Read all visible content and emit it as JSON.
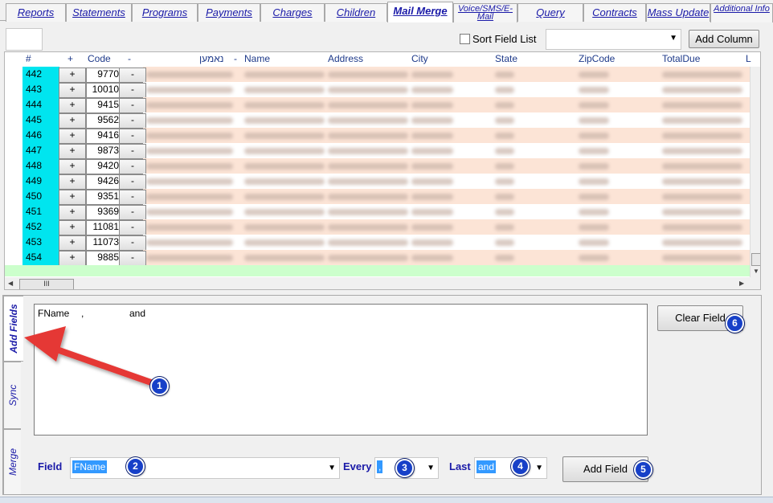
{
  "tabs": [
    {
      "label": "Reports"
    },
    {
      "label": "Statements"
    },
    {
      "label": "Programs"
    },
    {
      "label": "Payments"
    },
    {
      "label": "Charges"
    },
    {
      "label": "Children"
    },
    {
      "label": "Mail Merge"
    },
    {
      "label": "Voice/SMS/E-Mail"
    },
    {
      "label": "Query"
    },
    {
      "label": "Contracts"
    },
    {
      "label": "Mass Update"
    },
    {
      "label": "Additional Info"
    }
  ],
  "toolbar": {
    "sort_field_list": "Sort Field List",
    "add_column": "Add Column"
  },
  "grid": {
    "headers": {
      "num": "#",
      "plus": "+",
      "code": "Code",
      "minus": "-",
      "hebrew": "נאמען",
      "minus2": "-",
      "name": "Name",
      "address": "Address",
      "city": "City",
      "state": "State",
      "zipcode": "ZipCode",
      "totaldue": "TotalDue",
      "more": "L"
    },
    "plus_label": "+",
    "minus_label": "-",
    "hscroll_thumb": "III",
    "rows": [
      {
        "num": "442",
        "code": "9770"
      },
      {
        "num": "443",
        "code": "10010"
      },
      {
        "num": "444",
        "code": "9415"
      },
      {
        "num": "445",
        "code": "9562"
      },
      {
        "num": "446",
        "code": "9416"
      },
      {
        "num": "447",
        "code": "9873"
      },
      {
        "num": "448",
        "code": "9420"
      },
      {
        "num": "449",
        "code": "9426"
      },
      {
        "num": "450",
        "code": "9351"
      },
      {
        "num": "451",
        "code": "9369"
      },
      {
        "num": "452",
        "code": "11081"
      },
      {
        "num": "453",
        "code": "11073"
      },
      {
        "num": "454",
        "code": "9885"
      }
    ]
  },
  "side_tabs": {
    "add_fields": "Add Fields",
    "sync": "Sync",
    "merge": "Merge"
  },
  "editor": {
    "part1": "FName",
    "part2": ",",
    "part3": "and"
  },
  "controls": {
    "clear_field": "Clear Field",
    "field_label": "Field",
    "field_value": "FName",
    "every_label": "Every",
    "every_value": ",",
    "last_label": "Last",
    "last_value": "and",
    "add_field": "Add Field"
  },
  "badges": [
    "1",
    "2",
    "3",
    "4",
    "5",
    "6"
  ],
  "colors": {
    "tab_text": "#1a1aa8",
    "row_highlight": "#fce4d6",
    "number_column": "#00e5ef",
    "green_bar": "#ccffcc",
    "arrow": "#e53935",
    "badge": "#1740c8",
    "selection": "#3399ff"
  }
}
